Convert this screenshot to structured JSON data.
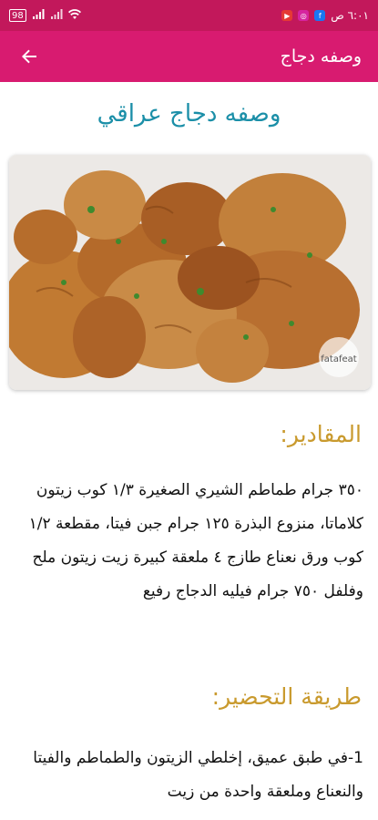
{
  "status_bar": {
    "time": "٦:٠١ ص",
    "battery": "98",
    "colors": {
      "background": "#c2185b"
    }
  },
  "appbar": {
    "title": "وصفه دجاج",
    "back_icon": "arrow-back-icon",
    "background": "#d81b70"
  },
  "recipe": {
    "title": "وصفه دجاج عراقي",
    "photo_icon": "fried-chicken-image",
    "photo_watermark": "fatafeat",
    "ingredients_heading": "المقادير:",
    "ingredients_text": "٣٥٠ جرام طماطم الشيري الصغيرة ١/٣ كوب زيتون كلاماتا، منزوع البذرة ١٢٥ جرام جبن فيتا، مقطعة ١/٢ كوب ورق نعناع طازج ٤ ملعقة كبيرة زيت زيتون ملح وفلفل ٧٥٠ جرام فيليه الدجاج رفيع",
    "method_heading": "طريقة التحضير:",
    "method_text": "1-في طبق عميق، إخلطي الزيتون والطماطم والفيتا والنعناع وملعقة واحدة من زيت",
    "title_color": "#1b8fa8",
    "heading_color": "#c99a2e"
  }
}
